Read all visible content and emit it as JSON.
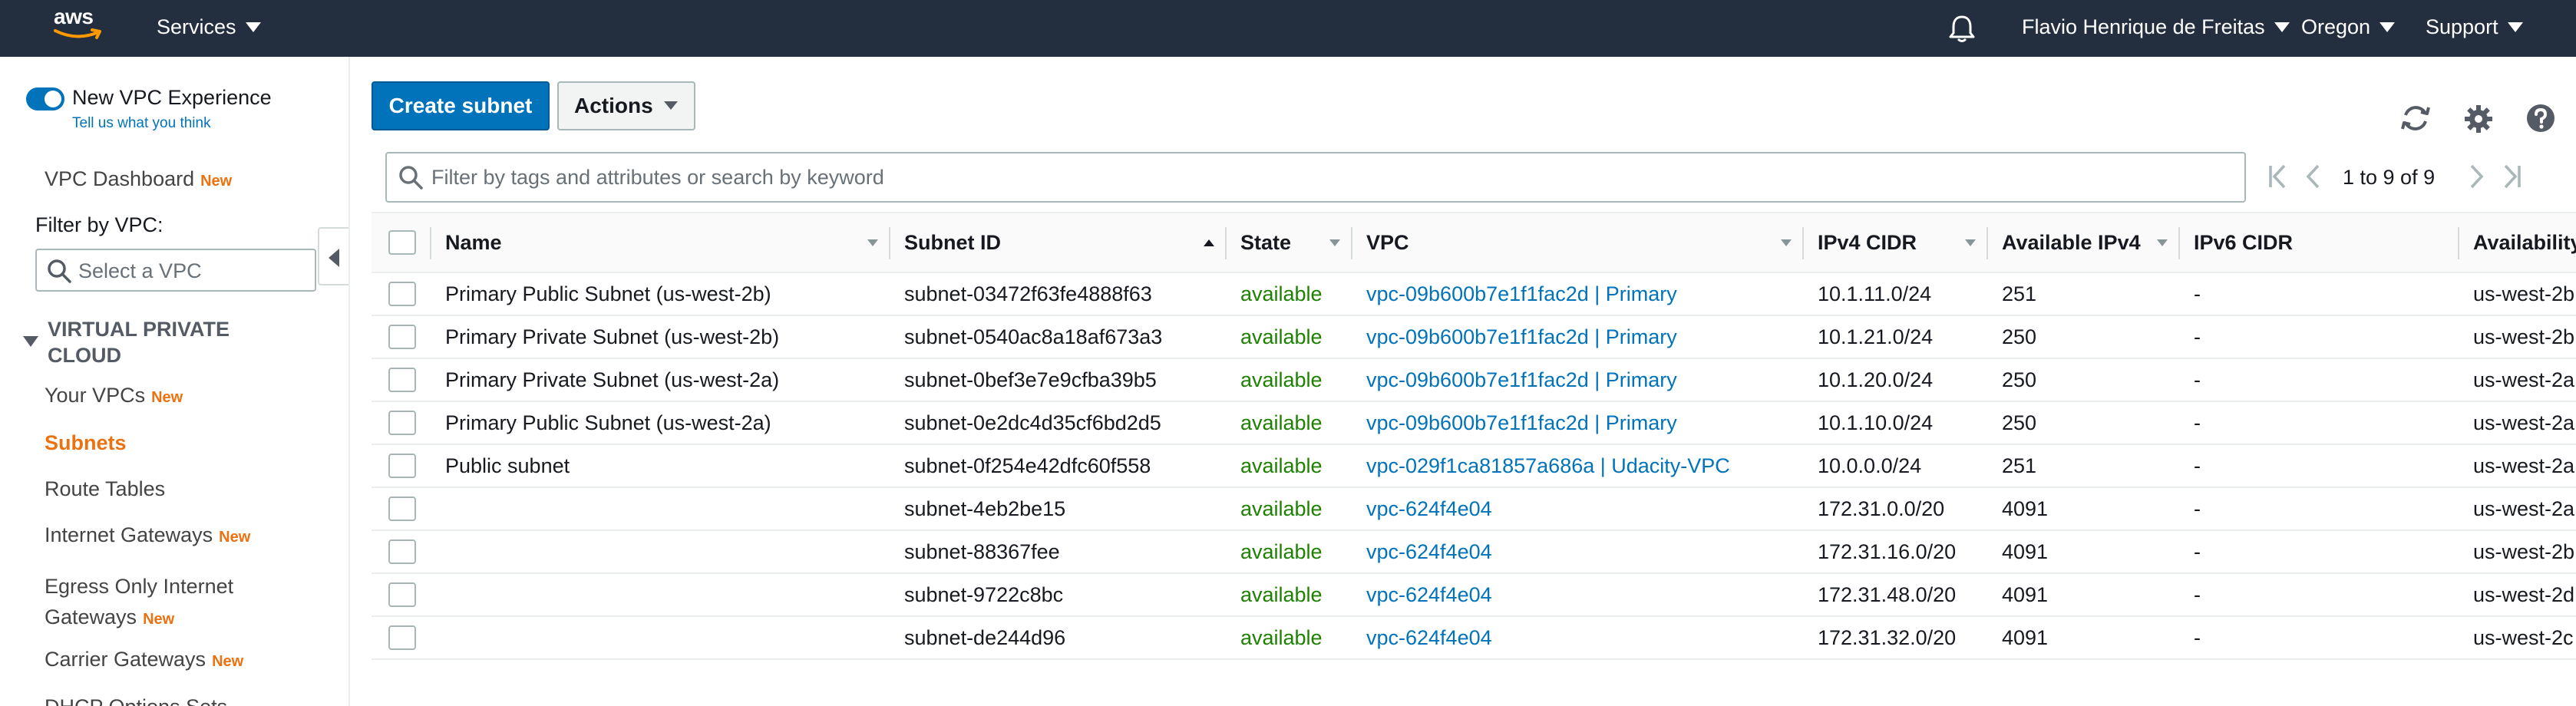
{
  "topbar": {
    "logo_text": "aws",
    "services": "Services",
    "user": "Flavio Henrique de Freitas",
    "region": "Oregon",
    "support": "Support"
  },
  "sidebar": {
    "toggle_label": "New VPC Experience",
    "feedback_link": "Tell us what you think",
    "dashboard": "VPC Dashboard",
    "new_badge": "New",
    "filter_label": "Filter by VPC:",
    "select_placeholder": "Select a VPC",
    "section_title": "VIRTUAL PRIVATE CLOUD",
    "items": [
      {
        "label": "Your VPCs",
        "badge": "New"
      },
      {
        "label": "Subnets",
        "badge": ""
      },
      {
        "label": "Route Tables",
        "badge": ""
      },
      {
        "label": "Internet Gateways",
        "badge": "New"
      },
      {
        "label": "Egress Only Internet Gateways",
        "badge": "New"
      },
      {
        "label": "Carrier Gateways",
        "badge": "New"
      },
      {
        "label": "DHCP Options Sets",
        "badge": ""
      }
    ]
  },
  "toolbar": {
    "create_label": "Create subnet",
    "actions_label": "Actions"
  },
  "search": {
    "placeholder": "Filter by tags and attributes or search by keyword"
  },
  "pagination": {
    "text": "1 to 9 of 9"
  },
  "table": {
    "columns": [
      "Name",
      "Subnet ID",
      "State",
      "VPC",
      "IPv4 CIDR",
      "Available IPv4",
      "IPv6 CIDR",
      "Availability"
    ],
    "rows": [
      {
        "name": "Primary Public Subnet (us-west-2b)",
        "subnet_id": "subnet-03472f63fe4888f63",
        "state": "available",
        "vpc": "vpc-09b600b7e1f1fac2d | Primary",
        "ipv4": "10.1.11.0/24",
        "avail": "251",
        "ipv6": "-",
        "az": "us-west-2b"
      },
      {
        "name": "Primary Private Subnet (us-west-2b)",
        "subnet_id": "subnet-0540ac8a18af673a3",
        "state": "available",
        "vpc": "vpc-09b600b7e1f1fac2d | Primary",
        "ipv4": "10.1.21.0/24",
        "avail": "250",
        "ipv6": "-",
        "az": "us-west-2b"
      },
      {
        "name": "Primary Private Subnet (us-west-2a)",
        "subnet_id": "subnet-0bef3e7e9cfba39b5",
        "state": "available",
        "vpc": "vpc-09b600b7e1f1fac2d | Primary",
        "ipv4": "10.1.20.0/24",
        "avail": "250",
        "ipv6": "-",
        "az": "us-west-2a"
      },
      {
        "name": "Primary Public Subnet (us-west-2a)",
        "subnet_id": "subnet-0e2dc4d35cf6bd2d5",
        "state": "available",
        "vpc": "vpc-09b600b7e1f1fac2d | Primary",
        "ipv4": "10.1.10.0/24",
        "avail": "250",
        "ipv6": "-",
        "az": "us-west-2a"
      },
      {
        "name": "Public subnet",
        "subnet_id": "subnet-0f254e42dfc60f558",
        "state": "available",
        "vpc": "vpc-029f1ca81857a686a | Udacity-VPC",
        "ipv4": "10.0.0.0/24",
        "avail": "251",
        "ipv6": "-",
        "az": "us-west-2a"
      },
      {
        "name": "",
        "subnet_id": "subnet-4eb2be15",
        "state": "available",
        "vpc": "vpc-624f4e04",
        "ipv4": "172.31.0.0/20",
        "avail": "4091",
        "ipv6": "-",
        "az": "us-west-2a"
      },
      {
        "name": "",
        "subnet_id": "subnet-88367fee",
        "state": "available",
        "vpc": "vpc-624f4e04",
        "ipv4": "172.31.16.0/20",
        "avail": "4091",
        "ipv6": "-",
        "az": "us-west-2b"
      },
      {
        "name": "",
        "subnet_id": "subnet-9722c8bc",
        "state": "available",
        "vpc": "vpc-624f4e04",
        "ipv4": "172.31.48.0/20",
        "avail": "4091",
        "ipv6": "-",
        "az": "us-west-2d"
      },
      {
        "name": "",
        "subnet_id": "subnet-de244d96",
        "state": "available",
        "vpc": "vpc-624f4e04",
        "ipv4": "172.31.32.0/20",
        "avail": "4091",
        "ipv6": "-",
        "az": "us-west-2c"
      }
    ]
  },
  "colors": {
    "nav_bg": "#232f3e",
    "primary": "#0073bb",
    "accent": "#ec7211",
    "state_green": "#1d8102"
  },
  "icons": [
    "bell-icon",
    "refresh-icon",
    "gear-icon",
    "help-icon",
    "search-icon",
    "first-page-icon",
    "prev-page-icon",
    "next-page-icon",
    "last-page-icon"
  ]
}
